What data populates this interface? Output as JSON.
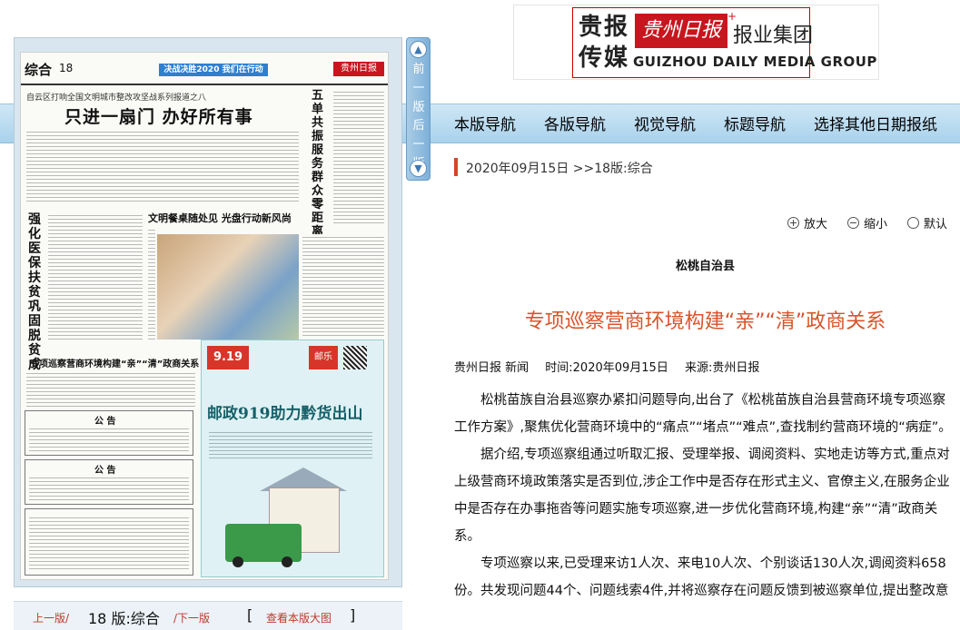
{
  "header": {
    "logo_left": "贵报\n传媒",
    "logo_red": "贵州日报",
    "logo_group": "报业集团",
    "logo_english": "GUIZHOU DAILY MEDIA GROUP"
  },
  "nav": {
    "items": [
      "本版导航",
      "各版导航",
      "视觉导航",
      "标题导航",
      "选择其他日期报纸"
    ]
  },
  "paper_thumbnail": {
    "section": "综合",
    "page_no": "18",
    "slogan": "决战决胜2020 我们在行动",
    "masthead": "贵州日报",
    "kicker": "自云区打响全国文明城市整改攻坚战系列报道之八",
    "headline": "只进一扇门  办好所有事",
    "side_headline": "五单共振  服务群众零距离",
    "vertical_headline": "强化医保扶贫 巩固脱贫成效",
    "photo_headline": "文明餐桌随处见  光盘行动新风尚",
    "third_headline": "专项巡察营商环境构建“亲”“清”政商关系",
    "notice_title": "公  告",
    "ad_date": "9.19",
    "ad_brand": "邮乐",
    "ad_title": "邮政919助力黔货出山"
  },
  "page_nav": {
    "prev": "前一版",
    "next": "后一版",
    "up_arrow": "▲",
    "down_arrow": "▼"
  },
  "bottom_bar": {
    "prev": "上一版/",
    "current": "18 版:综合",
    "next": "/下一版",
    "left_bracket": "[",
    "view_large": "查看本版大图",
    "right_bracket": "]"
  },
  "breadcrumb": {
    "date": "2020年09月15日",
    "separator": ">>",
    "section": "18版:综合"
  },
  "zoom": {
    "enlarge": "放大",
    "shrink": "缩小",
    "default": "默认",
    "enlarge_icon": "+",
    "shrink_icon": "−"
  },
  "article": {
    "kicker": "松桃自治县",
    "title": "专项巡察营商环境构建“亲”“清”政商关系",
    "byline": "贵州日报 新闻",
    "time": "时间:2020年09月15日",
    "source": "来源:贵州日报",
    "paragraphs": [
      "松桃苗族自治县巡察办紧扣问题导向,出台了《松桃苗族自治县营商环境专项巡察工作方案》,聚焦优化营商环境中的“痛点”“堵点”“难点”,查找制约营商环境的“病症”。",
      "据介绍,专项巡察组通过听取汇报、受理举报、调阅资料、实地走访等方式,重点对上级营商环境政策落实是否到位,涉企工作中是否存在形式主义、官僚主义,在服务企业中是否存在办事拖沓等问题实施专项巡察,进一步优化营商环境,构建“亲”“清”政商关系。",
      "专项巡察以来,已受理来访1人次、来电10人次、个别谈话130人次,调阅资料658份。共发现问题44个、问题线索4件,并将巡察存在问题反馈到被巡察单位,提出整改意"
    ]
  },
  "colors": {
    "accent_red": "#d9532b",
    "nav_blue": "#a9d2ec",
    "brand_red": "#c8161e"
  }
}
